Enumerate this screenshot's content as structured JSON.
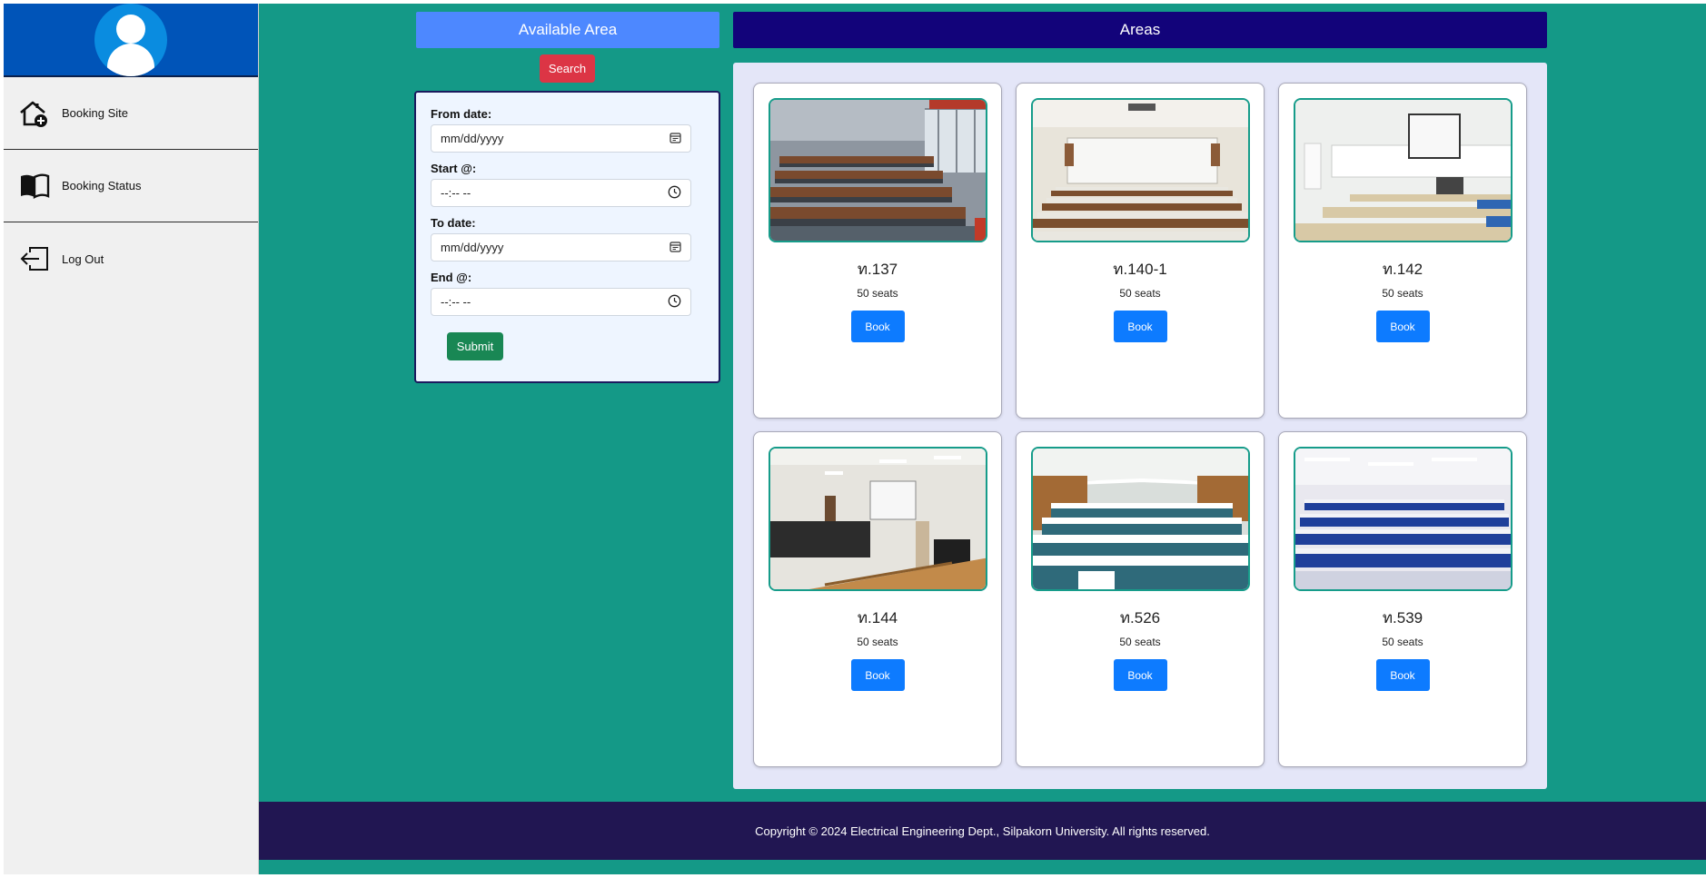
{
  "sidebar": {
    "items": [
      {
        "label": "Booking Site",
        "icon": "home-add-icon"
      },
      {
        "label": "Booking Status",
        "icon": "book-icon"
      },
      {
        "label": "Log Out",
        "icon": "logout-icon"
      }
    ]
  },
  "available": {
    "header": "Available Area",
    "search_label": "Search",
    "from_date_label": "From date:",
    "from_date_placeholder": "mm/dd/yyyy",
    "start_label": "Start @:",
    "start_placeholder": "--:-- --",
    "to_date_label": "To date:",
    "to_date_placeholder": "mm/dd/yyyy",
    "end_label": "End @:",
    "end_placeholder": "--:-- --",
    "submit_label": "Submit"
  },
  "areas": {
    "header": "Areas",
    "book_label": "Book",
    "rooms": [
      {
        "name": "ท.137",
        "seats": "50 seats"
      },
      {
        "name": "ท.140-1",
        "seats": "50 seats"
      },
      {
        "name": "ท.142",
        "seats": "50 seats"
      },
      {
        "name": "ท.144",
        "seats": "50 seats"
      },
      {
        "name": "ท.526",
        "seats": "50 seats"
      },
      {
        "name": "ท.539",
        "seats": "50 seats"
      }
    ]
  },
  "footer": {
    "text": "Copyright © 2024 Electrical Engineering Dept., Silpakorn University. All rights reserved."
  },
  "colors": {
    "background": "#149987",
    "profile": "#0054b8",
    "available_header": "#4d88ff",
    "areas_header": "#12037a",
    "search": "#dc3545",
    "submit": "#198754",
    "book": "#0d7bff",
    "footer": "#211652"
  }
}
